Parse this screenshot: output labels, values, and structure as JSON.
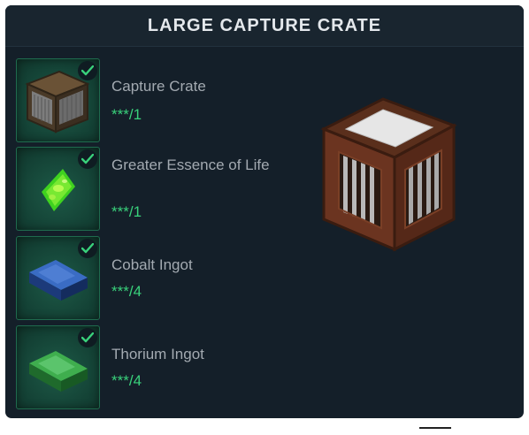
{
  "title": "LARGE CAPTURE CRATE",
  "ingredients": [
    {
      "name": "Capture Crate",
      "qty": "***/1",
      "icon": "capture-crate-icon",
      "status": "complete"
    },
    {
      "name": "Greater Essence of Life",
      "qty": "***/1",
      "icon": "greater-essence-of-life-icon",
      "status": "complete"
    },
    {
      "name": "Cobalt Ingot",
      "qty": "***/4",
      "icon": "cobalt-ingot-icon",
      "status": "complete"
    },
    {
      "name": "Thorium Ingot",
      "qty": "***/4",
      "icon": "thorium-ingot-icon",
      "status": "complete"
    }
  ],
  "preview": {
    "icon": "large-capture-crate-icon"
  },
  "colors": {
    "panel": "#141f29",
    "slot_border": "#1f6b4e",
    "check": "#39d17b",
    "quantity": "#39d17b",
    "title": "#e4e8ec"
  }
}
